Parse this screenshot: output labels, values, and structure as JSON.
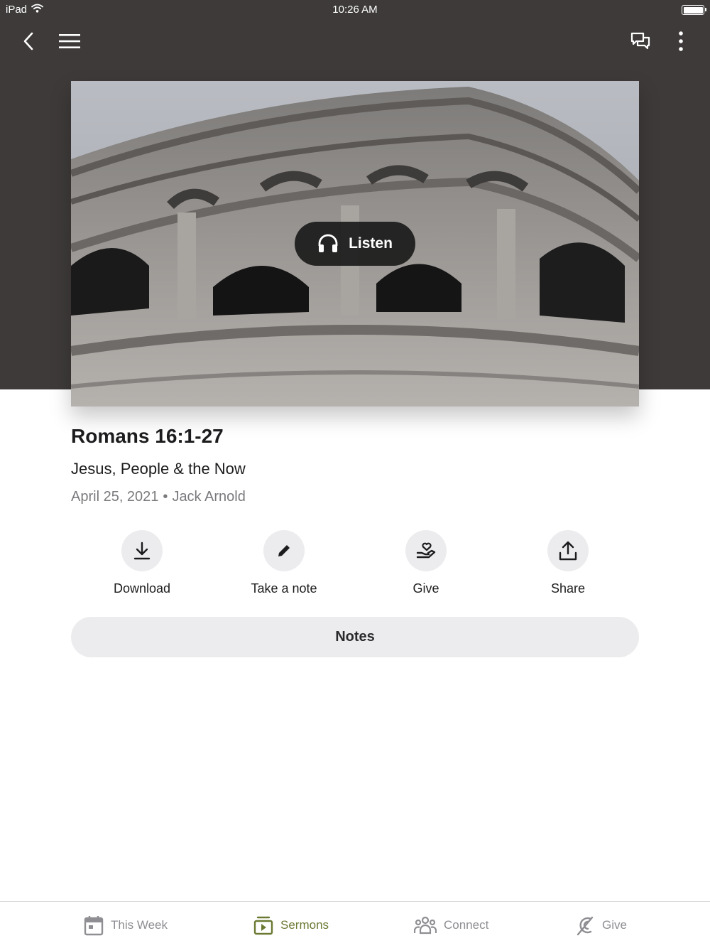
{
  "status_bar": {
    "device": "iPad",
    "time": "10:26 AM"
  },
  "nav": {
    "back_icon": "chevron-left-icon",
    "menu_icon": "hamburger-icon",
    "chat_icon": "chat-bubbles-icon",
    "more_icon": "more-vertical-icon"
  },
  "hero": {
    "listen_label": "Listen",
    "listen_icon": "headphones-icon"
  },
  "sermon": {
    "title": "Romans 16:1-27",
    "series": "Jesus, People & the Now",
    "date": "April 25, 2021",
    "separator": "•",
    "speaker": "Jack Arnold"
  },
  "actions": [
    {
      "label": "Download",
      "icon": "download-icon"
    },
    {
      "label": "Take a note",
      "icon": "pencil-icon"
    },
    {
      "label": "Give",
      "icon": "heart-hand-icon"
    },
    {
      "label": "Share",
      "icon": "share-icon"
    }
  ],
  "notes_label": "Notes",
  "tabs": [
    {
      "label": "This Week",
      "icon": "calendar-icon",
      "active": false
    },
    {
      "label": "Sermons",
      "icon": "video-play-icon",
      "active": true
    },
    {
      "label": "Connect",
      "icon": "people-icon",
      "active": false
    },
    {
      "label": "Give",
      "icon": "give-icon",
      "active": false
    }
  ],
  "colors": {
    "header_background": "#3e3a3a",
    "accent": "#6b7a33",
    "inactive_tab": "#8e8e93",
    "button_background": "#ececee"
  }
}
